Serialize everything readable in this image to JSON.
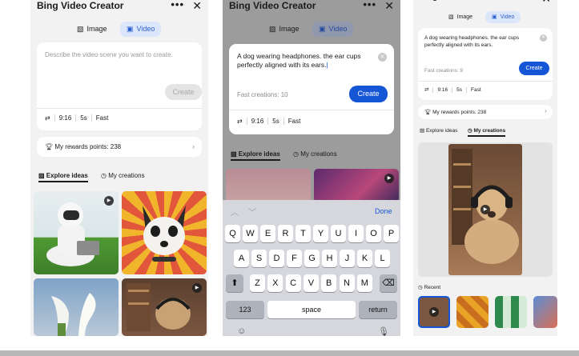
{
  "app": {
    "title": "Bing Video Creator",
    "more_icon": "more-dots-icon",
    "close_icon": "close-icon"
  },
  "tabs": {
    "image_label": "Image",
    "video_label": "Video"
  },
  "screen1": {
    "placeholder": "Describe the video scene you want to create.",
    "create_label": "Create",
    "settings": {
      "ratio": "9:16",
      "duration": "5s",
      "speed": "Fast"
    },
    "rewards": "My rewards points: 238",
    "explore_label": "Explore ideas",
    "creations_label": "My creations"
  },
  "screen2": {
    "prompt": "A dog wearing headphones. the ear cups perfectly aligned with its ears.",
    "fast_creations": "Fast creations: 10",
    "create_label": "Create",
    "settings": {
      "ratio": "9:16",
      "duration": "5s",
      "speed": "Fast"
    },
    "explore_label": "Explore ideas",
    "creations_label": "My creations",
    "keyboard": {
      "done_label": "Done",
      "row1": [
        "Q",
        "W",
        "E",
        "R",
        "T",
        "Y",
        "U",
        "I",
        "O",
        "P"
      ],
      "row2": [
        "A",
        "S",
        "D",
        "F",
        "G",
        "H",
        "J",
        "K",
        "L"
      ],
      "row3": [
        "Z",
        "X",
        "C",
        "V",
        "B",
        "N",
        "M"
      ],
      "num_label": "123",
      "space_label": "space",
      "return_label": "return"
    }
  },
  "screen3": {
    "prompt": "A dog wearing headphones. the ear cups perfectly aligned with its ears.",
    "fast_creations": "Fast creations: 9",
    "create_label": "Create",
    "settings": {
      "ratio": "9:16",
      "duration": "5s",
      "speed": "Fast"
    },
    "rewards": "My rewards points: 238",
    "explore_label": "Explore ideas",
    "creations_label": "My creations",
    "recent_label": "Recent"
  },
  "colors": {
    "accent": "#1556d6",
    "tab_active_bg": "#dbe6fb",
    "panel_bg": "#f2f2f2"
  }
}
